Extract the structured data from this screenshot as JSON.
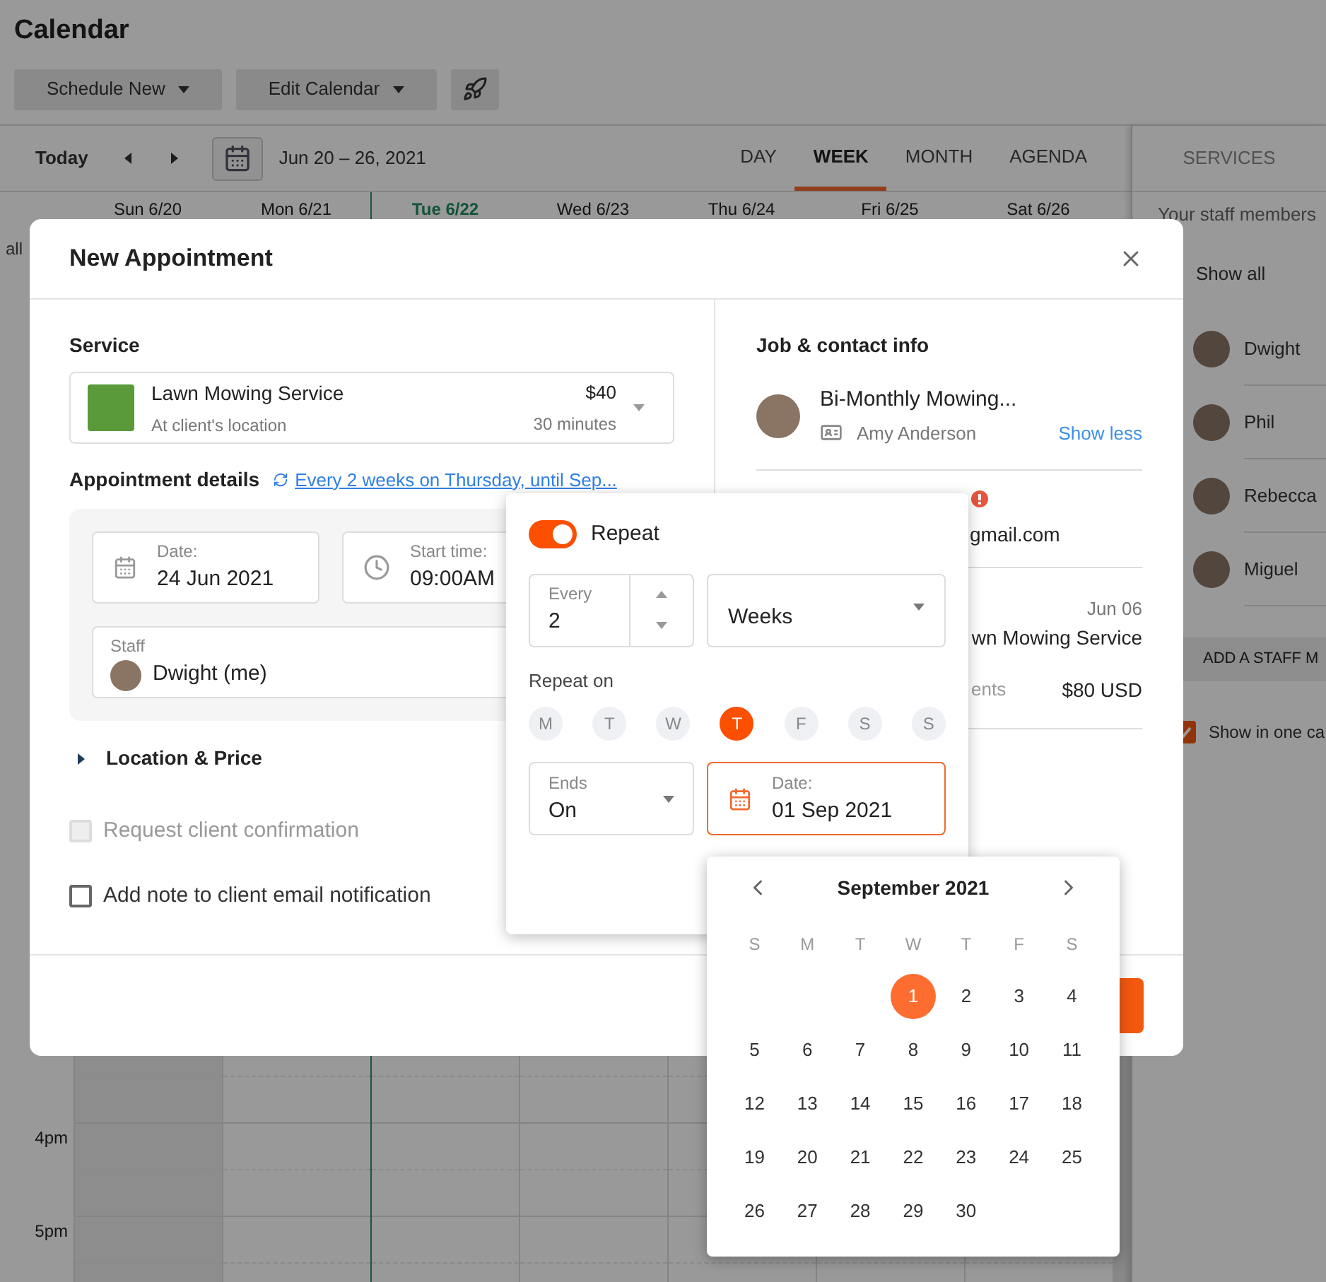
{
  "header": {
    "title": "Calendar",
    "buttons": [
      {
        "label": "Schedule New",
        "kind": "dropdown"
      },
      {
        "label": "Edit Calendar",
        "kind": "dropdown"
      },
      {
        "kind": "icon"
      }
    ]
  },
  "nav": {
    "today": "Today",
    "range": "Jun 20 – 26, 2021",
    "views": [
      {
        "label": "DAY",
        "selected": false
      },
      {
        "label": "WEEK",
        "selected": true
      },
      {
        "label": "MONTH",
        "selected": false
      },
      {
        "label": "AGENDA",
        "selected": false
      }
    ]
  },
  "week": {
    "days": [
      {
        "label": "Sun 6/20",
        "today": false
      },
      {
        "label": "Mon 6/21",
        "today": false
      },
      {
        "label": "Tue 6/22",
        "today": true
      },
      {
        "label": "Wed 6/23",
        "today": false
      },
      {
        "label": "Thu 6/24",
        "today": false
      },
      {
        "label": "Fri 6/25",
        "today": false
      },
      {
        "label": "Sat 6/26",
        "today": false
      }
    ],
    "all_day_label": "all",
    "hours": [
      "4pm",
      "5pm"
    ]
  },
  "side_panel": {
    "tab": "SERVICES",
    "intro": "Your staff members",
    "show_all": "Show all",
    "staff": [
      {
        "name": "Dwight"
      },
      {
        "name": "Phil"
      },
      {
        "name": "Rebecca"
      },
      {
        "name": "Miguel"
      }
    ],
    "add_staff": "ADD A STAFF M",
    "show_in_one": {
      "label": "Show in one ca",
      "checked": true
    }
  },
  "modal": {
    "title": "New Appointment",
    "service": {
      "label": "Service",
      "name": "Lawn Mowing Service",
      "location": "At client's location",
      "price": "$40",
      "duration": "30 minutes"
    },
    "details": {
      "label": "Appointment details",
      "recurrence": "Every 2 weeks on Thursday, until Sep...",
      "date_label": "Date:",
      "date": "24 Jun 2021",
      "time_label": "Start time:",
      "time": "09:00AM",
      "staff_label": "Staff",
      "staff": "Dwight (me)"
    },
    "location_price": {
      "label": "Location & Price",
      "expanded": false
    },
    "options": [
      {
        "label": "Request client confirmation",
        "checked": false,
        "disabled": true
      },
      {
        "label": "Add note to client email notification",
        "checked": false,
        "disabled": false
      }
    ],
    "contact": {
      "label": "Job & contact info",
      "job": "Bi-Monthly Mowing...",
      "client": "Amy Anderson",
      "toggle": "Show less",
      "email": "gmail.com",
      "last_date": "Jun 06",
      "last_service": "wn Mowing Service",
      "total_label": "ents",
      "total": "$80 USD"
    }
  },
  "repeat": {
    "label": "Repeat",
    "on": true,
    "every_label": "Every",
    "every": "2",
    "unit": "Weeks",
    "repeat_on_label": "Repeat on",
    "days": [
      {
        "label": "M",
        "selected": false
      },
      {
        "label": "T",
        "selected": false
      },
      {
        "label": "W",
        "selected": false
      },
      {
        "label": "T",
        "selected": true
      },
      {
        "label": "F",
        "selected": false
      },
      {
        "label": "S",
        "selected": false
      },
      {
        "label": "S",
        "selected": false
      }
    ],
    "ends_label": "Ends",
    "ends": "On",
    "date_label": "Date:",
    "date": "01 Sep 2021"
  },
  "date_picker": {
    "month": "September 2021",
    "weekdays": [
      "S",
      "M",
      "T",
      "W",
      "T",
      "F",
      "S"
    ],
    "weeks": [
      [
        {
          "label": "1",
          "selected": true
        },
        {
          "label": "2",
          "selected": false
        },
        {
          "label": "3",
          "selected": false
        },
        {
          "label": "4",
          "selected": false
        }
      ],
      [
        {
          "label": "5",
          "selected": false
        },
        {
          "label": "6",
          "selected": false
        },
        {
          "label": "7",
          "selected": false
        },
        {
          "label": "8",
          "selected": false
        },
        {
          "label": "9",
          "selected": false
        },
        {
          "label": "10",
          "selected": false
        },
        {
          "label": "11",
          "selected": false
        }
      ],
      [
        {
          "label": "12",
          "selected": false
        },
        {
          "label": "13",
          "selected": false
        },
        {
          "label": "14",
          "selected": false
        },
        {
          "label": "15",
          "selected": false
        },
        {
          "label": "16",
          "selected": false
        },
        {
          "label": "17",
          "selected": false
        },
        {
          "label": "18",
          "selected": false
        }
      ],
      [
        {
          "label": "19",
          "selected": false
        },
        {
          "label": "20",
          "selected": false
        },
        {
          "label": "21",
          "selected": false
        },
        {
          "label": "22",
          "selected": false
        },
        {
          "label": "23",
          "selected": false
        },
        {
          "label": "24",
          "selected": false
        },
        {
          "label": "25",
          "selected": false
        }
      ],
      [
        {
          "label": "26",
          "selected": false
        },
        {
          "label": "27",
          "selected": false
        },
        {
          "label": "28",
          "selected": false
        },
        {
          "label": "29",
          "selected": false
        },
        {
          "label": "30",
          "selected": false
        }
      ]
    ]
  }
}
